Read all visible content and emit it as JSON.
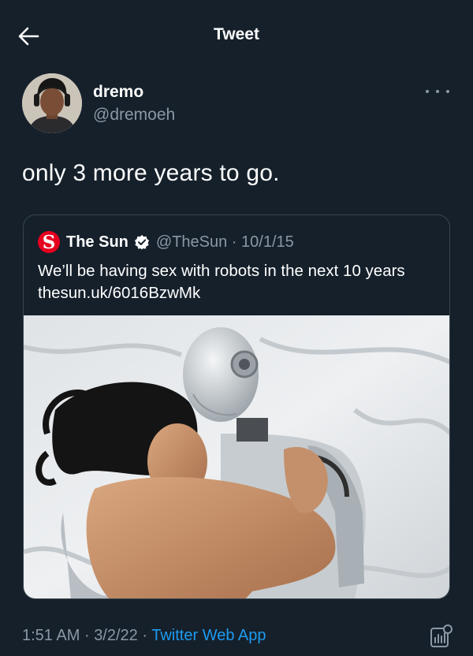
{
  "header": {
    "title": "Tweet",
    "back_icon": "arrow-left-icon"
  },
  "tweet": {
    "author_name": "dremo",
    "author_handle": "@dremoeh",
    "text": "only 3 more years to go.",
    "more_icon": "more-horizontal-icon",
    "time": "1:51 AM",
    "date": "3/2/22",
    "source": "Twitter Web App",
    "separator": "·"
  },
  "quoted_tweet": {
    "logo_letter": "S",
    "author_name": "The Sun",
    "handle_date": "@TheSun · 10/1/15",
    "text": "We’ll be having sex with robots in the next 10 years thesun.uk/6016BzwMk",
    "verified_icon": "verified-badge-icon"
  },
  "colors": {
    "background": "#15202b",
    "muted_text": "#8b98a5",
    "link": "#1d9bf0",
    "border": "#38444d",
    "sun_red": "#e6001f"
  }
}
